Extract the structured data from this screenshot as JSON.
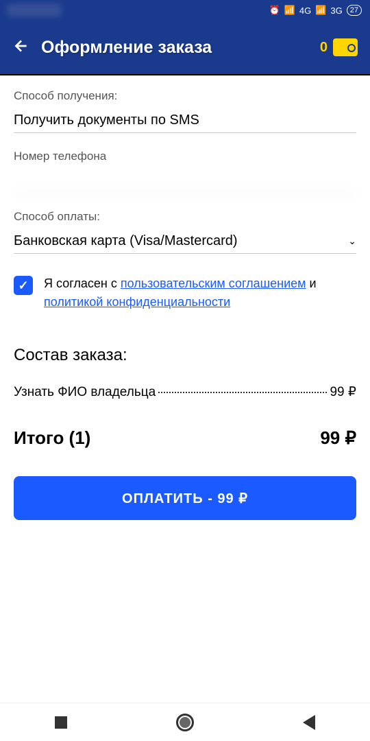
{
  "status": {
    "network1": "4G",
    "network2": "3G",
    "battery": "27"
  },
  "header": {
    "title": "Оформление заказа",
    "wallet_balance": "0"
  },
  "form": {
    "delivery_label": "Способ получения:",
    "delivery_value": "Получить документы по SMS",
    "phone_label": "Номер телефона",
    "phone_value": "",
    "payment_label": "Способ оплаты:",
    "payment_value": "Банковская карта (Visa/Mastercard)"
  },
  "consent": {
    "prefix": "Я согласен с ",
    "link1": "пользовательским соглашением",
    "middle": " и ",
    "link2": "политикой конфиденциальности"
  },
  "order": {
    "section_title": "Состав заказа:",
    "item_name": "Узнать ФИО владельца",
    "item_price": "99 ₽",
    "total_label": "Итого (1)",
    "total_price": "99  ₽"
  },
  "pay_button": "ОПЛАТИТЬ - 99  ₽"
}
